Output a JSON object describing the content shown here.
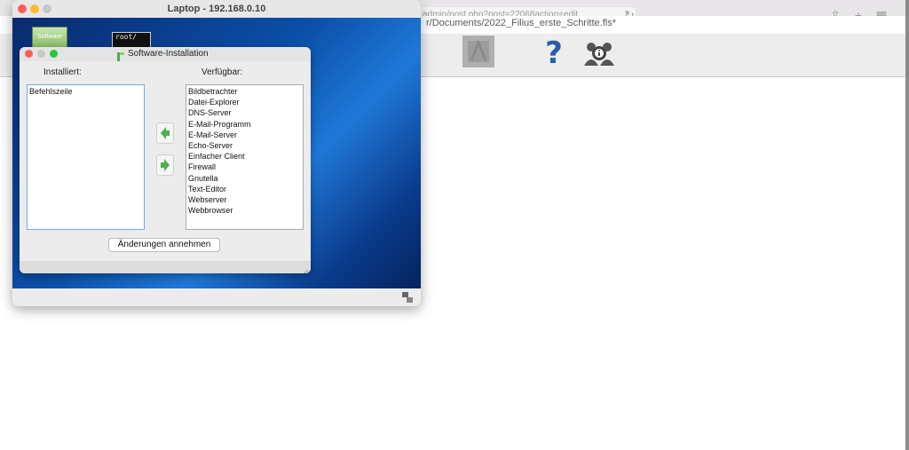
{
  "browser": {
    "url_fragment": "admin/post.php?post=22068action=edit"
  },
  "app": {
    "title": "r/Documents/2022_Filius_erste_Schritte.fls*"
  },
  "laptop": {
    "title": "Laptop - 192.168.0.10",
    "traffic_lights": [
      "#ff5f57",
      "#febc2e",
      "#28c840"
    ],
    "desktop_icons": {
      "terminal_text": "root/",
      "software_text": "Software"
    }
  },
  "dialog": {
    "title": "Software-Installation",
    "installed_label": "Installiert:",
    "available_label": "Verfügbar:",
    "installed": [
      "Befehlszeile"
    ],
    "available": [
      "Bildbetrachter",
      "Datei-Explorer",
      "DNS-Server",
      "E-Mail-Programm",
      "E-Mail-Server",
      "Echo-Server",
      "Einfacher Client",
      "Firewall",
      "Gnutella",
      "Text-Editor",
      "Webserver",
      "Webbrowser"
    ],
    "apply_label": "Änderungen annehmen",
    "arrow_color": "#4caf50"
  },
  "icons": {
    "dialog": "filius-app-icon",
    "add": "arrow-left-icon",
    "remove": "arrow-right-icon",
    "help": "question-mark-icon",
    "about": "info-people-icon",
    "status": "network-status-icon"
  }
}
